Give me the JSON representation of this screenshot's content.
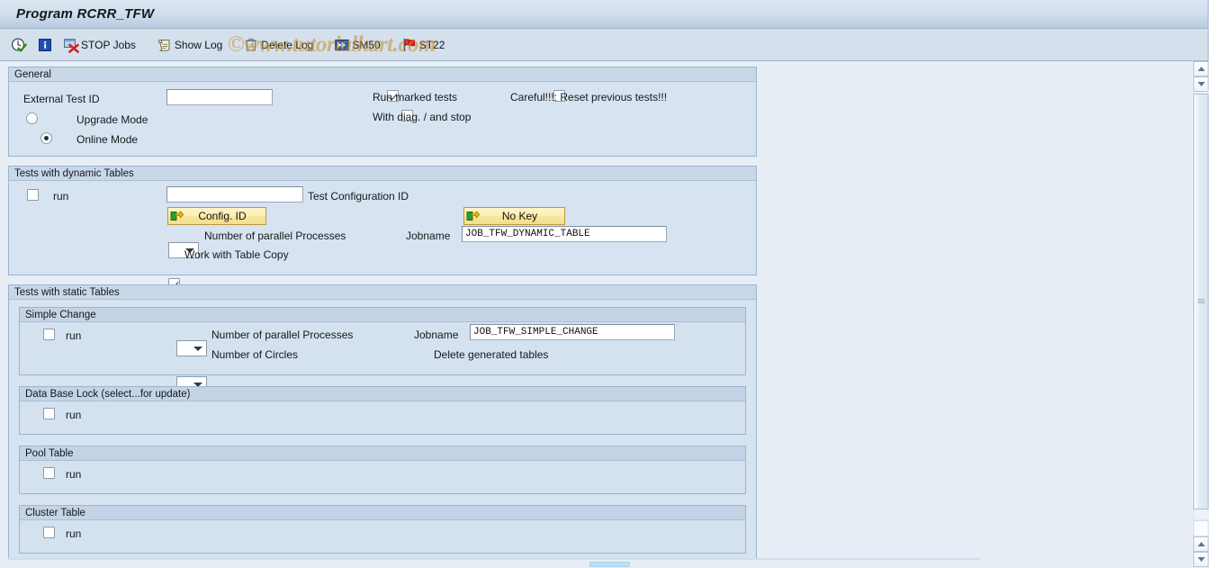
{
  "window": {
    "title": "Program RCRR_TFW"
  },
  "watermark": {
    "text": "©www.tutorialkart.com"
  },
  "toolbar": {
    "items": [
      {
        "label": "",
        "icon": "execute-clock-icon",
        "name": "execute-button"
      },
      {
        "label": "",
        "icon": "info-icon",
        "name": "info-button"
      },
      {
        "label": "STOP Jobs",
        "icon": "stop-jobs-icon",
        "name": "stop-jobs-button"
      },
      {
        "label": "Show Log",
        "icon": "show-log-icon",
        "name": "show-log-button"
      },
      {
        "label": "Delete Log",
        "icon": "delete-log-trash-icon",
        "name": "delete-log-button"
      },
      {
        "label": "SM50",
        "icon": "sm50-forward-icon",
        "name": "sm50-button"
      },
      {
        "label": "ST22",
        "icon": "st22-flag-icon",
        "name": "st22-button"
      }
    ]
  },
  "general": {
    "title": "General",
    "external_test_id": {
      "label": "External Test ID",
      "value": "",
      "placeholder": ""
    },
    "radios": [
      {
        "label": "Upgrade Mode",
        "checked": false
      },
      {
        "label": "Online Mode",
        "checked": true
      }
    ],
    "checkboxes": [
      {
        "label": "Run marked tests",
        "checked": true
      },
      {
        "label": "With diag. / and stop",
        "checked": false
      },
      {
        "label": "Careful!!!: Reset previous tests!!!",
        "checked": false
      }
    ]
  },
  "dynamic_tables": {
    "title": "Tests with dynamic Tables",
    "run": {
      "label": "run",
      "checked": false
    },
    "test_config_id": {
      "label": "Test Configuration ID",
      "value": "",
      "placeholder": ""
    },
    "config_id_button": {
      "label": "Config. ID"
    },
    "no_key_button": {
      "label": "No Key"
    },
    "parallel_processes": {
      "label": "Number of parallel Processes",
      "value": ""
    },
    "jobname": {
      "label": "Jobname",
      "value": "JOB_TFW_DYNAMIC_TABLE"
    },
    "work_with_table_copy": {
      "label": "Work with Table Copy",
      "checked": true
    }
  },
  "static_tables": {
    "title": "Tests with static Tables",
    "simple_change": {
      "title": "Simple Change",
      "run": {
        "label": "run",
        "checked": false
      },
      "parallel_processes": {
        "label": "Number of parallel Processes",
        "value": ""
      },
      "number_of_circles": {
        "label": "Number of Circles",
        "value": ""
      },
      "jobname": {
        "label": "Jobname",
        "value": "JOB_TFW_SIMPLE_CHANGE"
      },
      "delete_generated_tables": {
        "label": "Delete generated tables",
        "checked": false
      }
    },
    "database_lock": {
      "title": "Data Base Lock (select...for update)",
      "run": {
        "label": "run",
        "checked": false
      }
    },
    "pool_table": {
      "title": "Pool Table",
      "run": {
        "label": "run",
        "checked": false
      }
    },
    "cluster_table": {
      "title": "Cluster Table",
      "run": {
        "label": "run",
        "checked": false
      }
    }
  },
  "colors": {
    "titlebar_start": "#dbe5f1",
    "titlebar_end": "#b9cbe0",
    "toolbar_bg": "#d5e0ed",
    "content_bg": "#e8eef6",
    "group_bg": "#d7e3f0",
    "group_header_bg": "#c9d8e8",
    "border": "#9cb4cf",
    "button_yellow": "#f7e79c",
    "watermark": "#c48e28"
  }
}
